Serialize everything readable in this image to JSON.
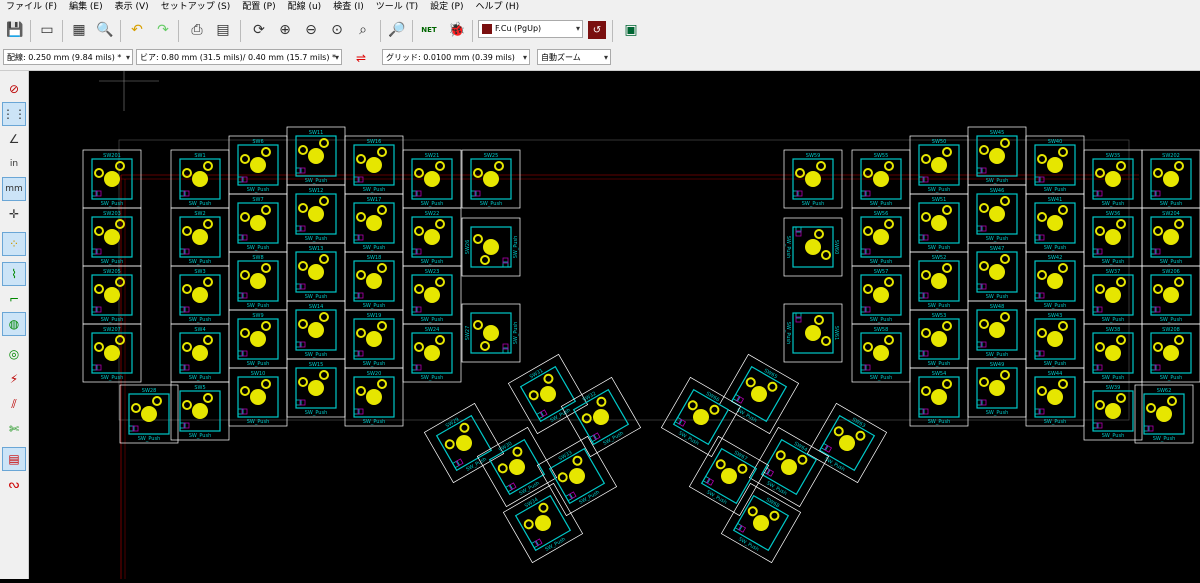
{
  "menu": [
    "ファイル (F)",
    "編集 (E)",
    "表示 (V)",
    "セットアップ (S)",
    "配置 (P)",
    "配線 (u)",
    "検査 (I)",
    "ツール (T)",
    "設定 (P)",
    "ヘルプ (H)"
  ],
  "toolbar": {
    "layer_select": "F.Cu (PgUp)",
    "net_label": "NET"
  },
  "toolbar2": {
    "track_width": "配線: 0.250 mm (9.84 mils) *",
    "via_size": "ビア: 0.80 mm (31.5 mils)/ 0.40 mm (15.7 mils) *",
    "grid": "グリッド: 0.0100 mm (0.39 mils)",
    "zoom": "自動ズーム"
  },
  "colors": {
    "background": "#000000",
    "footprint_outline": "#ffffff",
    "courtyard": "#00c8c8",
    "pad": "#e6e600",
    "silk": "#00c8c8",
    "ratsnest": "#c00000"
  },
  "keyboard": {
    "left_column_refs": [
      "SW201",
      "SW203",
      "SW205",
      "SW207"
    ],
    "right_column_refs": [
      "SW202",
      "SW204",
      "SW206",
      "SW208"
    ],
    "footprint_value": "SW_Push"
  }
}
